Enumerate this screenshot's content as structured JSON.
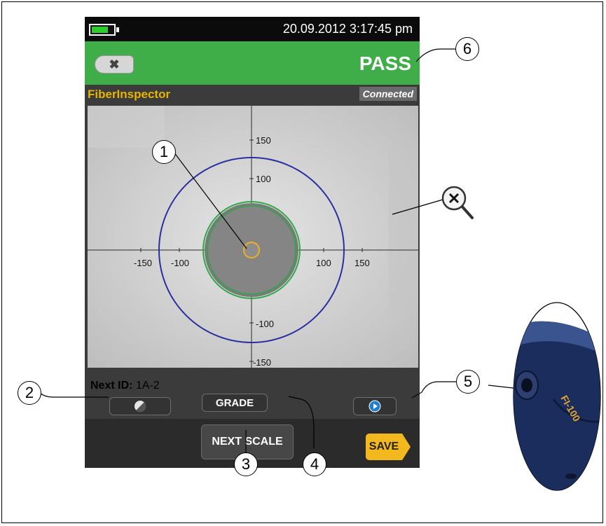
{
  "status_bar": {
    "datetime": "20.09.2012 3:17:45 pm",
    "battery_level": 0.75
  },
  "header": {
    "result": "PASS",
    "back_icon": "close-x-icon"
  },
  "app": {
    "title": "FiberInspector",
    "connection": "Connected"
  },
  "scale": {
    "y_labels": [
      "150",
      "100",
      "-100",
      "-150"
    ],
    "x_labels": [
      "-150",
      "-100",
      "100",
      "150"
    ]
  },
  "next_id": {
    "label": "Next ID:",
    "value": "1A-2"
  },
  "buttons": {
    "overlay_icon": "half-circle-icon",
    "grade": "GRADE",
    "play_icon": "play-icon",
    "next_scale": "NEXT SCALE",
    "save": "SAVE"
  },
  "callouts": {
    "c1": "1",
    "c2": "2",
    "c3": "3",
    "c4": "4",
    "c5": "5",
    "c6": "6"
  },
  "probe": {
    "label": "FI-100"
  },
  "colors": {
    "header_green": "#3fae48",
    "title_yellow": "#e8b400",
    "zone_blue": "#2b2fa0",
    "zone_green": "#2fa84a",
    "core_yellow": "#f0b020",
    "save_yellow": "#f2b81d",
    "probe_blue": "#1b2d5c"
  }
}
